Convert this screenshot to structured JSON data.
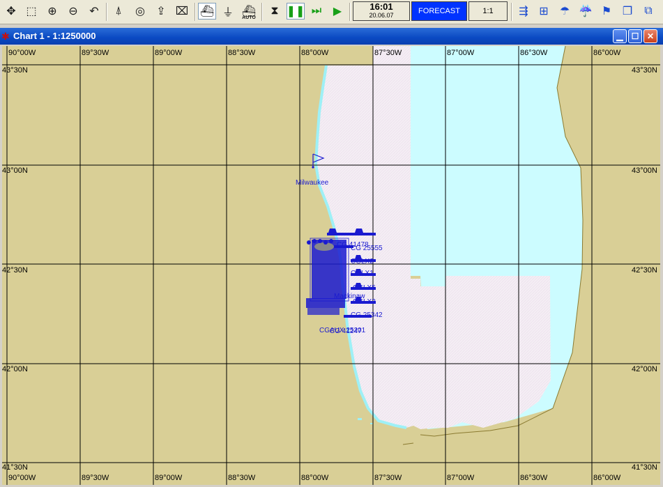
{
  "toolbar": {
    "clock_time": "16:01",
    "clock_date": "20.06.07",
    "forecast_label": "FORECAST",
    "scale_label": "1:1",
    "auto_label": "AUTO",
    "accent_color": "#0033ff"
  },
  "window": {
    "title": "Chart 1 - 1:1250000",
    "minimize_icon": "minimize-icon",
    "maximize_icon": "maximize-icon",
    "close_icon": "close-icon"
  },
  "chart": {
    "lon_labels": [
      "90°00W",
      "89°30W",
      "89°00W",
      "88°30W",
      "88°00W",
      "87°30W",
      "87°00W",
      "86°30W",
      "86°00W"
    ],
    "lat_labels": [
      "43°30N",
      "43°00N",
      "42°30N",
      "42°00N",
      "41°30N"
    ],
    "land_color": "#d9cf96",
    "water_color": "#f4eef4",
    "shallow_color": "#ccfcff",
    "marker_color": "#1a1ad0",
    "place_label": "Milwaukee",
    "vessel_labels": [
      "CG 41478",
      "CG 25555",
      "CGLX2",
      "CGLX1",
      "CGLX5",
      "CGLX3",
      "CG 25342",
      "Mackinaw",
      "CG 41247",
      "CGAUX 25201"
    ]
  }
}
